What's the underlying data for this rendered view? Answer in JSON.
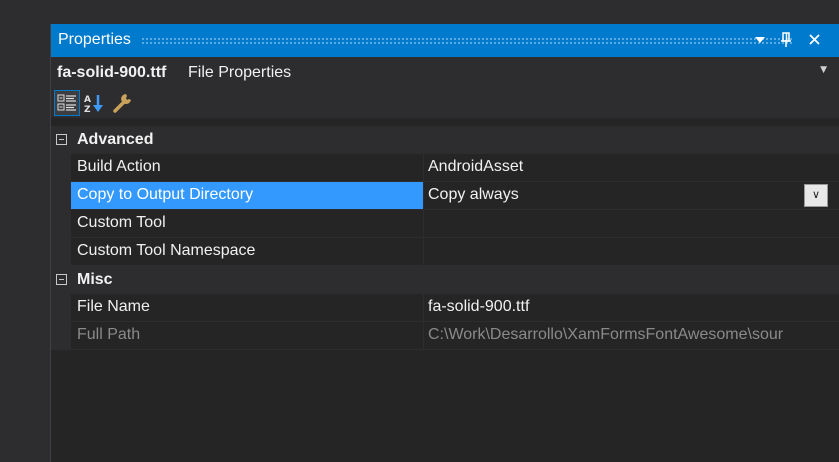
{
  "window": {
    "title": "Properties"
  },
  "object_selector": {
    "name": "fa-solid-900.ttf",
    "kind": "File Properties"
  },
  "toolbar": {
    "buttons": [
      {
        "icon": "categorized-icon",
        "active": true
      },
      {
        "icon": "alphabetical-sort-icon",
        "active": false
      },
      {
        "icon": "property-pages-wrench-icon",
        "active": false
      }
    ]
  },
  "categories": [
    {
      "label": "Advanced",
      "properties": [
        {
          "name": "Build Action",
          "value": "AndroidAsset"
        },
        {
          "name": "Copy to Output Directory",
          "value": "Copy always"
        },
        {
          "name": "Custom Tool",
          "value": ""
        },
        {
          "name": "Custom Tool Namespace",
          "value": ""
        }
      ]
    },
    {
      "label": "Misc",
      "properties": [
        {
          "name": "File Name",
          "value": "fa-solid-900.ttf"
        },
        {
          "name": "Full Path",
          "value": "C:\\Work\\Desarrollo\\XamFormsFontAwesome\\sour"
        }
      ]
    }
  ],
  "colors": {
    "accent": "#007acc",
    "selection": "#3399ff",
    "panel_bg": "#252526",
    "chrome_bg": "#2d2d30",
    "text": "#f1f1f1",
    "disabled_text": "#8a8a8a"
  }
}
